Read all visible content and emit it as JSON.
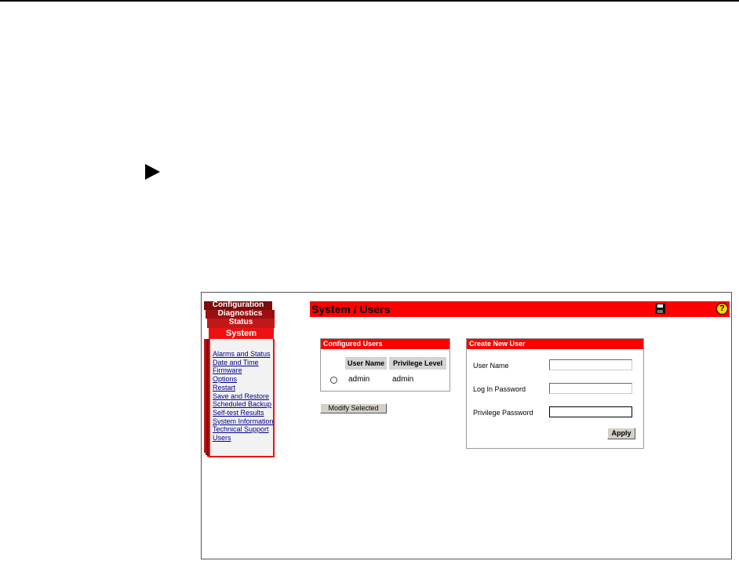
{
  "sidebar": {
    "tabs": [
      "Configuration",
      "Diagnostics",
      "Status",
      "System"
    ],
    "menu": [
      "Alarms and Status",
      "Date and Time",
      "Firmware",
      "Options",
      "Restart",
      "Save and Restore",
      "Scheduled Backup",
      "Self-test Results",
      "System Information",
      "Technical Support",
      "Users"
    ]
  },
  "header": {
    "title": "System / Users",
    "save_icon": "save-icon",
    "help_icon": "help-icon",
    "help_glyph": "?"
  },
  "configured_users": {
    "title": "Configured Users",
    "columns": [
      "User Name",
      "Privilege Level"
    ],
    "rows": [
      {
        "user_name": "admin",
        "privilege_level": "admin"
      }
    ],
    "modify_button": "Modify Selected"
  },
  "create_user": {
    "title": "Create New User",
    "fields": [
      {
        "label": "User Name",
        "value": ""
      },
      {
        "label": "Log In Password",
        "value": ""
      },
      {
        "label": "Privilege Password",
        "value": ""
      }
    ],
    "apply_button": "Apply"
  },
  "colors": {
    "accent": "#ff0000",
    "tab_dark": "#7a0c0c",
    "link": "#00008b"
  }
}
